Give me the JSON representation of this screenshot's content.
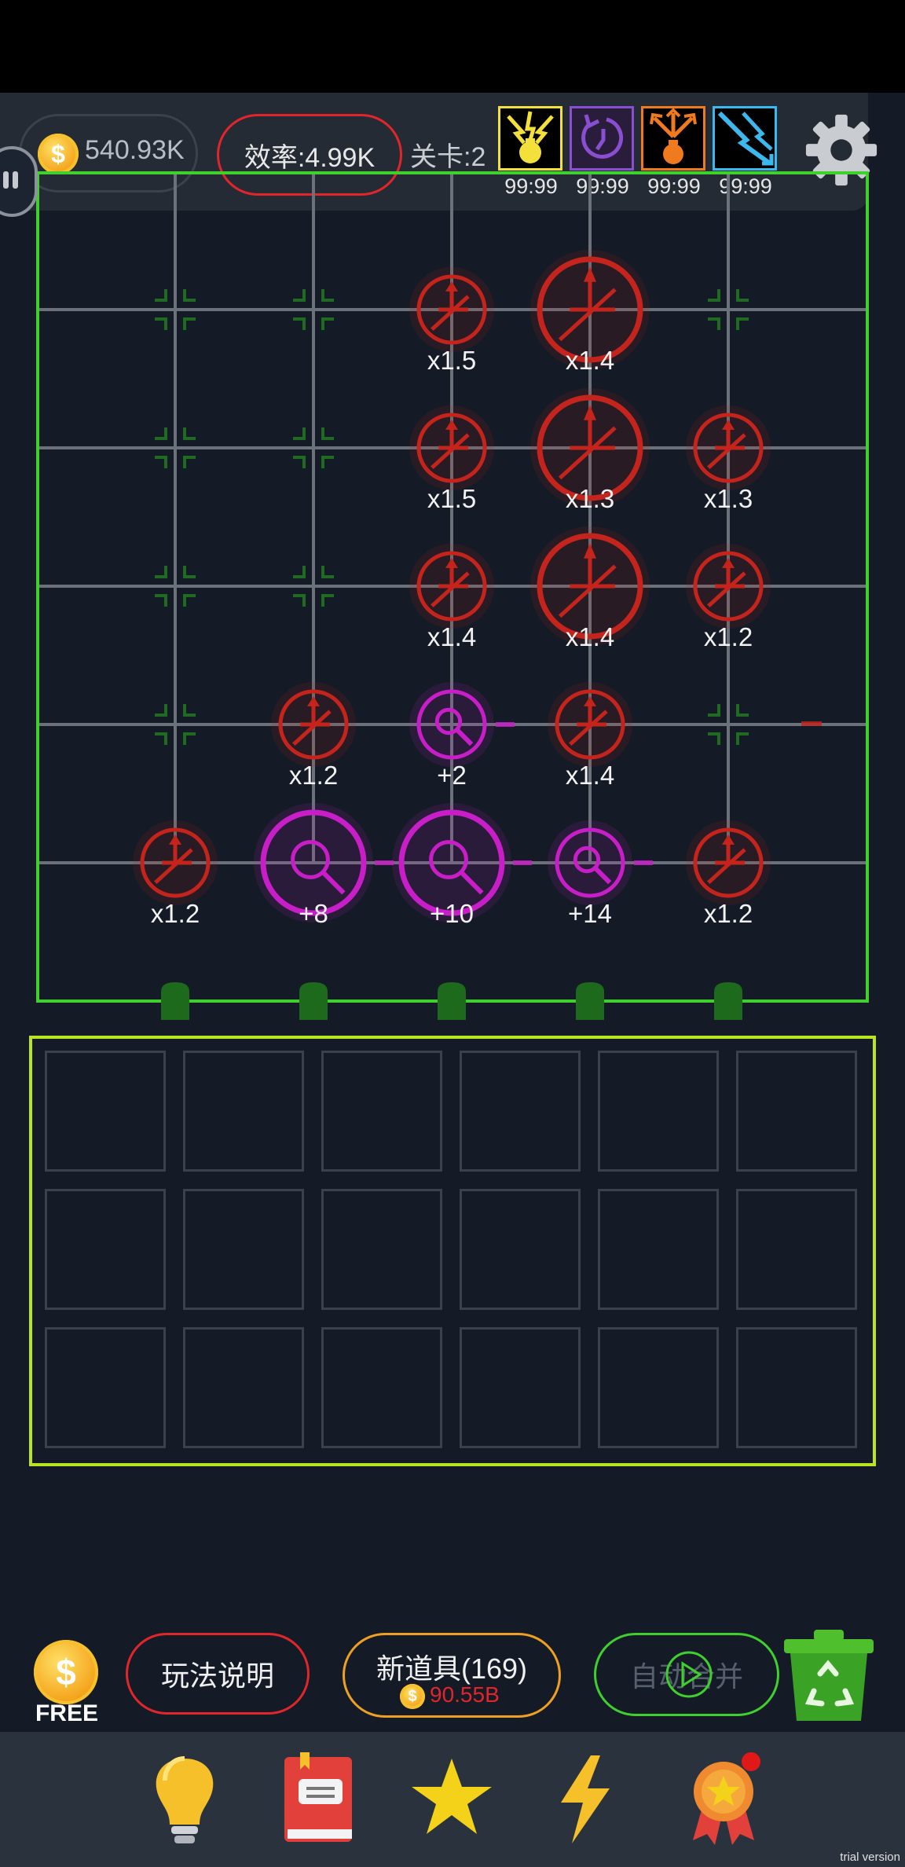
{
  "hud": {
    "coins": "540.93K",
    "efficiency": "效率:4.99K",
    "level": "关卡:2",
    "powerups": [
      {
        "name": "lightning-bomb-icon",
        "count": "99:99",
        "color": "#f4e03a"
      },
      {
        "name": "rewind-icon",
        "count": "99:99",
        "color": "#8a4fd0"
      },
      {
        "name": "split-bomb-icon",
        "count": "99:99",
        "color": "#f07a1e"
      },
      {
        "name": "lightning-strike-icon",
        "count": "99:99",
        "color": "#3bb8ee"
      }
    ]
  },
  "board": {
    "cells": [
      {
        "row": 0,
        "col": 2,
        "kind": "turret",
        "size": "small",
        "label": "x1.5"
      },
      {
        "row": 0,
        "col": 3,
        "kind": "turret",
        "size": "large",
        "label": "x1.4"
      },
      {
        "row": 1,
        "col": 2,
        "kind": "turret",
        "size": "small",
        "label": "x1.5"
      },
      {
        "row": 1,
        "col": 3,
        "kind": "turret",
        "size": "large",
        "label": "x1.3"
      },
      {
        "row": 1,
        "col": 4,
        "kind": "turret",
        "size": "small",
        "label": "x1.3"
      },
      {
        "row": 2,
        "col": 2,
        "kind": "turret",
        "size": "small",
        "label": "x1.4"
      },
      {
        "row": 2,
        "col": 3,
        "kind": "turret",
        "size": "large",
        "label": "x1.4"
      },
      {
        "row": 2,
        "col": 4,
        "kind": "turret",
        "size": "small",
        "label": "x1.2"
      },
      {
        "row": 3,
        "col": 1,
        "kind": "turret",
        "size": "small",
        "label": "x1.2"
      },
      {
        "row": 3,
        "col": 2,
        "kind": "magnifier",
        "size": "small",
        "label": "+2"
      },
      {
        "row": 3,
        "col": 3,
        "kind": "turret",
        "size": "small",
        "label": "x1.4"
      },
      {
        "row": 4,
        "col": 0,
        "kind": "turret",
        "size": "small",
        "label": "x1.2"
      },
      {
        "row": 4,
        "col": 1,
        "kind": "magnifier",
        "size": "large",
        "label": "+8"
      },
      {
        "row": 4,
        "col": 2,
        "kind": "magnifier",
        "size": "large",
        "label": "+10"
      },
      {
        "row": 4,
        "col": 3,
        "kind": "magnifier",
        "size": "small",
        "label": "+14"
      },
      {
        "row": 4,
        "col": 4,
        "kind": "turret",
        "size": "small",
        "label": "x1.2"
      }
    ],
    "empty_markers": [
      {
        "row": 0,
        "col": 0
      },
      {
        "row": 0,
        "col": 1
      },
      {
        "row": 0,
        "col": 4
      },
      {
        "row": 1,
        "col": 0
      },
      {
        "row": 1,
        "col": 1
      },
      {
        "row": 2,
        "col": 0
      },
      {
        "row": 2,
        "col": 1
      },
      {
        "row": 3,
        "col": 0
      },
      {
        "row": 3,
        "col": 4
      }
    ],
    "colors": {
      "turret": "#c4241c",
      "magnifier": "#c81ec8",
      "frame": "#3fd02e",
      "marker": "#1f6b22"
    }
  },
  "inventory": {
    "rows": 3,
    "cols": 6
  },
  "actions": {
    "free_label": "FREE",
    "help_label": "玩法说明",
    "new_item_label": "新道具(169)",
    "new_item_cost": "90.55B",
    "auto_merge_label": "自动合并"
  },
  "nav": [
    {
      "name": "lightbulb-icon"
    },
    {
      "name": "book-icon"
    },
    {
      "name": "star-icon"
    },
    {
      "name": "lightning-icon"
    },
    {
      "name": "medal-icon"
    }
  ],
  "watermark": "trial version"
}
